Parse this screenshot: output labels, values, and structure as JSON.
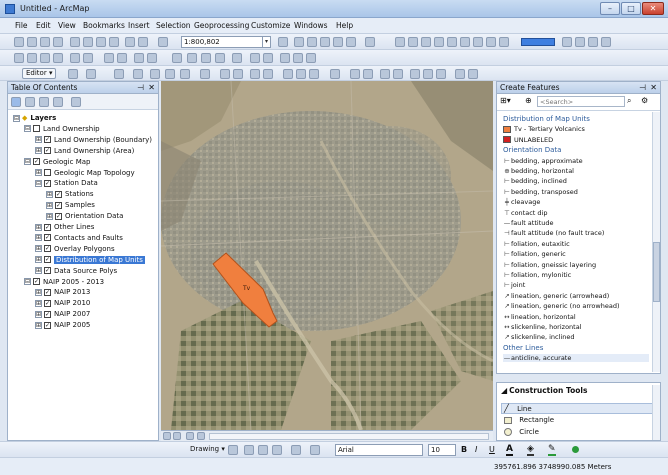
{
  "window": {
    "title": "Untitled - ArcMap",
    "minimize": "–",
    "maximize": "□",
    "close": "✕"
  },
  "menus": [
    "File",
    "Edit",
    "View",
    "Bookmarks",
    "Insert",
    "Selection",
    "Geoprocessing",
    "Customize",
    "Windows",
    "Help"
  ],
  "toolbar": {
    "scale": "1:800,802",
    "editor": "Editor ▾"
  },
  "toc": {
    "title": "Table Of Contents",
    "rows": [
      {
        "label": "Layers",
        "expand": "⊟",
        "check": false,
        "bold": true
      },
      {
        "label": "Land Ownership",
        "expand": "⊟",
        "check": true
      },
      {
        "label": "Land Ownership (Boundary)",
        "expand": "⊞",
        "check": true
      },
      {
        "label": "Land Ownership (Area)",
        "expand": "⊞",
        "check": true
      },
      {
        "label": "Geologic Map",
        "expand": "⊟",
        "check": true
      },
      {
        "label": "Geologic Map Topology",
        "expand": "⊞",
        "check": true
      },
      {
        "label": "Station Data",
        "expand": "⊟",
        "check": true
      },
      {
        "label": "Stations",
        "expand": "⊞",
        "check": true
      },
      {
        "label": "Samples",
        "expand": "⊞",
        "check": true
      },
      {
        "label": "Orientation Data",
        "expand": "⊞",
        "check": true
      },
      {
        "label": "Other Lines",
        "expand": "⊞",
        "check": true
      },
      {
        "label": "Contacts and Faults",
        "expand": "⊞",
        "check": true
      },
      {
        "label": "Overlay Polygons",
        "expand": "⊞",
        "check": true
      },
      {
        "label": "Distribution of Map Units",
        "expand": "⊞",
        "check": true,
        "selected": true
      },
      {
        "label": "Data Source Polys",
        "expand": "⊞",
        "check": true
      },
      {
        "label": "NAIP 2005 - 2013",
        "expand": "⊟",
        "check": true
      },
      {
        "label": "NAIP 2013",
        "expand": "⊞",
        "check": true
      },
      {
        "label": "NAIP 2010",
        "expand": "⊞",
        "check": true
      },
      {
        "label": "NAIP 2007",
        "expand": "⊞",
        "check": true
      },
      {
        "label": "NAIP 2005",
        "expand": "⊞",
        "check": true
      }
    ]
  },
  "map": {
    "polygon_label": "Tv"
  },
  "create_features": {
    "title": "Create Features",
    "search_placeholder": "<Search>",
    "rows": [
      {
        "type": "section",
        "label": "Distribution of Map Units"
      },
      {
        "type": "item",
        "label": "Tv - Tertiary Volcanics",
        "swatch": "#f07f3e"
      },
      {
        "type": "item",
        "label": "UNLABELED",
        "swatch": "#d32020"
      },
      {
        "type": "section",
        "label": "Orientation Data"
      },
      {
        "type": "item",
        "label": "bedding, approximate",
        "sym": "⊢"
      },
      {
        "type": "item",
        "label": "bedding, horizontal",
        "sym": "⊕"
      },
      {
        "type": "item",
        "label": "bedding, inclined",
        "sym": "⊢"
      },
      {
        "type": "item",
        "label": "bedding, transposed",
        "sym": "⊢"
      },
      {
        "type": "item",
        "label": "cleavage",
        "sym": "╪"
      },
      {
        "type": "item",
        "label": "contact dip",
        "sym": "⊤"
      },
      {
        "type": "item",
        "label": "fault attitude",
        "sym": "—"
      },
      {
        "type": "item",
        "label": "fault attitude (no fault trace)",
        "sym": "⊣"
      },
      {
        "type": "item",
        "label": "foliation, eutaxitic",
        "sym": "⊢"
      },
      {
        "type": "item",
        "label": "foliation, generic",
        "sym": "⊢"
      },
      {
        "type": "item",
        "label": "foliation, gneissic layering",
        "sym": "⊢"
      },
      {
        "type": "item",
        "label": "foliation, mylonitic",
        "sym": "⊢"
      },
      {
        "type": "item",
        "label": "joint",
        "sym": "⊢"
      },
      {
        "type": "item",
        "label": "lineation, generic (arrowhead)",
        "sym": "↗"
      },
      {
        "type": "item",
        "label": "lineation, generic (no arrowhead)",
        "sym": "↗"
      },
      {
        "type": "item",
        "label": "lineation, horizontal",
        "sym": "↔"
      },
      {
        "type": "item",
        "label": "slickenline, horizontal",
        "sym": "↔"
      },
      {
        "type": "item",
        "label": "slickenline, inclined",
        "sym": "↗"
      },
      {
        "type": "section",
        "label": "Other Lines"
      },
      {
        "type": "item",
        "label": "anticline, accurate",
        "sym": "—"
      }
    ]
  },
  "construction_tools": {
    "title": "Construction Tools",
    "items": [
      "Line",
      "Rectangle",
      "Circle"
    ]
  },
  "drawbar": {
    "drawing": "Drawing ▾",
    "font": "Arial",
    "size": "10",
    "bold": "B",
    "italic": "I",
    "underline": "U"
  },
  "status": {
    "coords": "395761.896  3748990.085 Meters"
  },
  "colors": {
    "polygon": "#f07f3e",
    "selection": "#3a78d4"
  }
}
